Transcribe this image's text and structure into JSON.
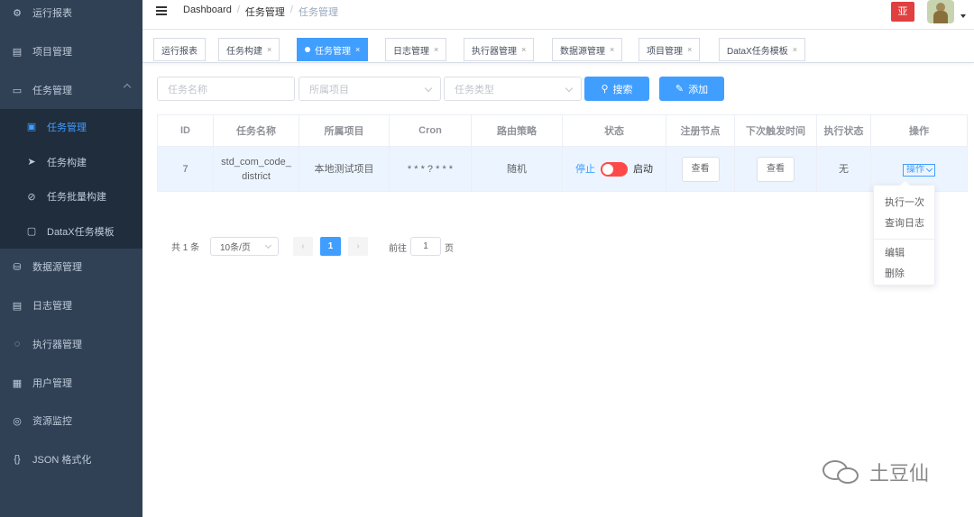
{
  "sidebar": {
    "items": [
      {
        "label": "运行报表",
        "icon": "dashboard-icon",
        "glyph": "⚙"
      },
      {
        "label": "项目管理",
        "icon": "project-icon",
        "glyph": "▤"
      },
      {
        "label": "任务管理",
        "icon": "task-icon",
        "glyph": "▭"
      },
      {
        "label": "任务管理",
        "icon": "task-list-icon",
        "glyph": "▣"
      },
      {
        "label": "任务构建",
        "icon": "send-icon",
        "glyph": "➤"
      },
      {
        "label": "任务批量构建",
        "icon": "batch-icon",
        "glyph": "⊘"
      },
      {
        "label": "DataX任务模板",
        "icon": "template-icon",
        "glyph": "▢"
      },
      {
        "label": "数据源管理",
        "icon": "datasource-icon",
        "glyph": "⛁"
      },
      {
        "label": "日志管理",
        "icon": "log-icon",
        "glyph": "▤"
      },
      {
        "label": "执行器管理",
        "icon": "executor-icon",
        "glyph": "◌"
      },
      {
        "label": "用户管理",
        "icon": "user-table-icon",
        "glyph": "▦"
      },
      {
        "label": "资源监控",
        "icon": "monitor-icon",
        "glyph": "◎"
      },
      {
        "label": "JSON 格式化",
        "icon": "json-icon",
        "glyph": "{}"
      }
    ]
  },
  "breadcrumb": {
    "items": [
      "Dashboard",
      "任务管理",
      "任务管理"
    ],
    "sep": "/"
  },
  "header": {
    "badge": "亚"
  },
  "tags": [
    {
      "label": "运行报表",
      "close": ""
    },
    {
      "label": "任务构建",
      "close": "×"
    },
    {
      "label": "任务管理",
      "close": "×"
    },
    {
      "label": "日志管理",
      "close": "×"
    },
    {
      "label": "执行器管理",
      "close": "×"
    },
    {
      "label": "数据源管理",
      "close": "×"
    },
    {
      "label": "项目管理",
      "close": "×"
    },
    {
      "label": "DataX任务模板",
      "close": "×"
    }
  ],
  "filters": {
    "task_name_placeholder": "任务名称",
    "project_placeholder": "所属项目",
    "task_type_placeholder": "任务类型",
    "search_label": "搜索",
    "search_icon": "⚲",
    "add_label": "添加",
    "add_icon": "✎"
  },
  "table": {
    "headers": [
      "ID",
      "任务名称",
      "所属项目",
      "Cron",
      "路由策略",
      "状态",
      "注册节点",
      "下次触发时间",
      "执行状态",
      "操作"
    ],
    "rows": [
      {
        "id": "7",
        "name": "std_com_code_district",
        "project": "本地测试项目",
        "cron": "* * * ? * * *",
        "route": "随机",
        "status_off": "停止",
        "status_on": "启动",
        "view_nodes": "查看",
        "view_next": "查看",
        "exec_status": "无",
        "op_label": "操作"
      }
    ]
  },
  "dropdown": {
    "items": [
      "执行一次",
      "查询日志",
      "编辑",
      "删除"
    ]
  },
  "pagination": {
    "total": "共 1 条",
    "page_size": "10条/页",
    "prev": "‹",
    "page": "1",
    "next": "›",
    "goto_label": "前往",
    "goto_value": "1",
    "goto_suffix": "页"
  },
  "watermark": {
    "text": "土豆仙"
  },
  "colors": {
    "primary": "#409eff",
    "sidebar": "#304156",
    "danger": "#ff4949"
  }
}
